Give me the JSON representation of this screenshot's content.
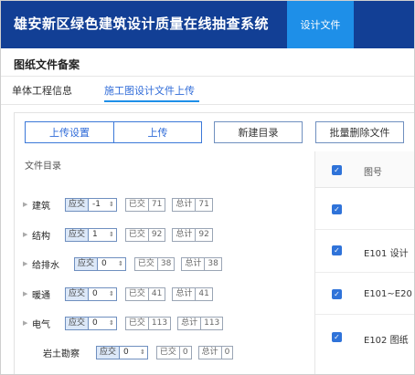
{
  "header": {
    "title": "雄安新区绿色建筑设计质量在线抽查系统",
    "active_tab": "设计文件"
  },
  "page_title": "图纸文件备案",
  "tabs": {
    "basic": "单体工程信息",
    "upload": "施工图设计文件上传"
  },
  "toolbar": {
    "upload_setting": "上传设置",
    "upload": "上传",
    "new_dir": "新建目录",
    "batch_delete": "批量删除文件"
  },
  "dir_header": "文件目录",
  "right_header": "图号",
  "categories": [
    {
      "name": "建筑",
      "select_label": "应交",
      "value": "-1",
      "submitted_label": "已交",
      "submitted": "71",
      "total_label": "总计",
      "total": "71"
    },
    {
      "name": "结构",
      "select_label": "应交",
      "value": "1",
      "submitted_label": "已交",
      "submitted": "92",
      "total_label": "总计",
      "total": "92"
    },
    {
      "name": "给排水",
      "select_label": "应交",
      "value": "0",
      "submitted_label": "已交",
      "submitted": "38",
      "total_label": "总计",
      "total": "38"
    },
    {
      "name": "暖通",
      "select_label": "应交",
      "value": "0",
      "submitted_label": "已交",
      "submitted": "41",
      "total_label": "总计",
      "total": "41"
    },
    {
      "name": "电气",
      "select_label": "应交",
      "value": "0",
      "submitted_label": "已交",
      "submitted": "113",
      "total_label": "总计",
      "total": "113"
    },
    {
      "name": "岩土勘察",
      "select_label": "应交",
      "value": "0",
      "submitted_label": "已交",
      "submitted": "0",
      "total_label": "总计",
      "total": "0"
    }
  ],
  "files": [
    {
      "code": ""
    },
    {
      "code": "E101 设计"
    },
    {
      "code": "E101~E20"
    },
    {
      "code": "E102 图纸"
    }
  ],
  "colors": {
    "header_bg": "#123f95",
    "active_tab": "#1e8fe8",
    "accent": "#2f73d9"
  }
}
